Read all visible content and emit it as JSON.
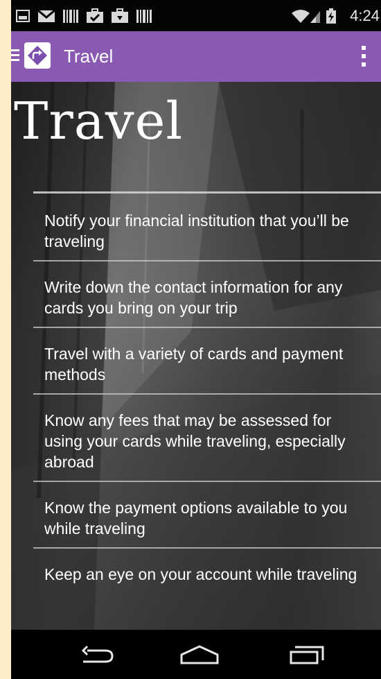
{
  "status_bar": {
    "time": "4:24",
    "icons": [
      "picture-icon",
      "gmail-icon",
      "barcode-icon",
      "briefcase-check-icon",
      "briefcase-download-icon",
      "barcode-icon",
      "wifi-icon",
      "signal-icon",
      "battery-charging-icon"
    ]
  },
  "action_bar": {
    "title": "Travel",
    "color": "#8a59b1"
  },
  "content": {
    "title": "Travel",
    "tips": [
      "Notify your financial institution that you’ll be traveling",
      "Write down the contact information for any cards you bring on your trip",
      "Travel with a variety of cards and payment methods",
      "Know any fees that may be assessed for using your cards while traveling, especially abroad",
      "Know the payment options available to you while traveling",
      "Keep an eye on your account while traveling"
    ]
  },
  "nav_bar": {
    "buttons": [
      "back-icon",
      "home-icon",
      "recent-apps-icon"
    ]
  }
}
